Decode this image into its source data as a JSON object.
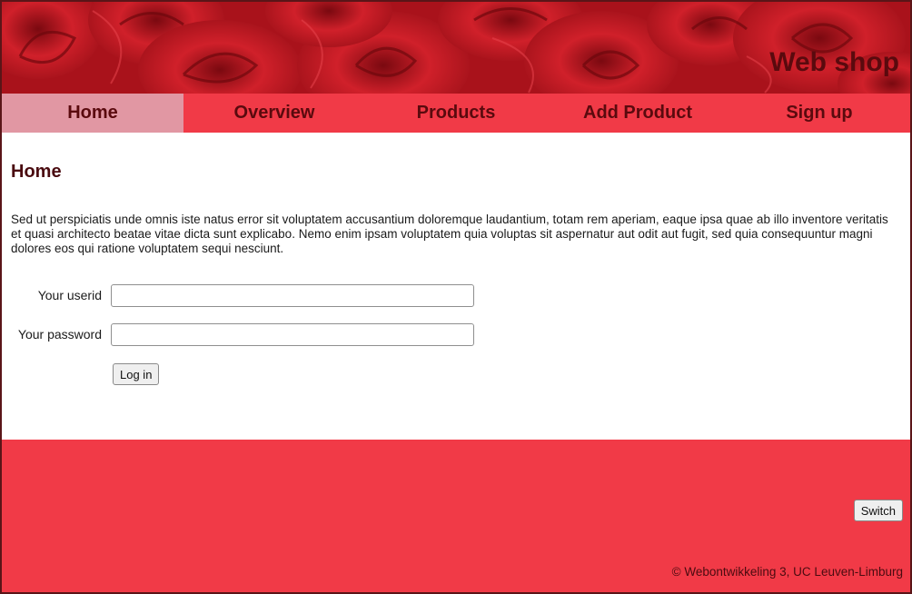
{
  "header": {
    "site_title": "Web shop"
  },
  "nav": {
    "items": [
      {
        "label": "Home",
        "active": true
      },
      {
        "label": "Overview",
        "active": false
      },
      {
        "label": "Products",
        "active": false
      },
      {
        "label": "Add Product",
        "active": false
      },
      {
        "label": "Sign up",
        "active": false
      }
    ]
  },
  "main": {
    "heading": "Home",
    "intro": "Sed ut perspiciatis unde omnis iste natus error sit voluptatem accusantium doloremque laudantium, totam rem aperiam, eaque ipsa quae ab illo inventore veritatis et quasi architecto beatae vitae dicta sunt explicabo. Nemo enim ipsam voluptatem quia voluptas sit aspernatur aut odit aut fugit, sed quia consequuntur magni dolores eos qui ratione voluptatem sequi nesciunt.",
    "form": {
      "userid_label": "Your userid",
      "userid_value": "",
      "password_label": "Your password",
      "password_value": "",
      "login_label": "Log in"
    }
  },
  "footer": {
    "switch_label": "Switch",
    "copyright": "© Webontwikkeling 3, UC Leuven-Limburg"
  },
  "colors": {
    "nav_bg": "#f13a47",
    "nav_active_bg": "#e197a3",
    "text_dark_red": "#5a0a0e",
    "header_red": "#b8141e"
  }
}
